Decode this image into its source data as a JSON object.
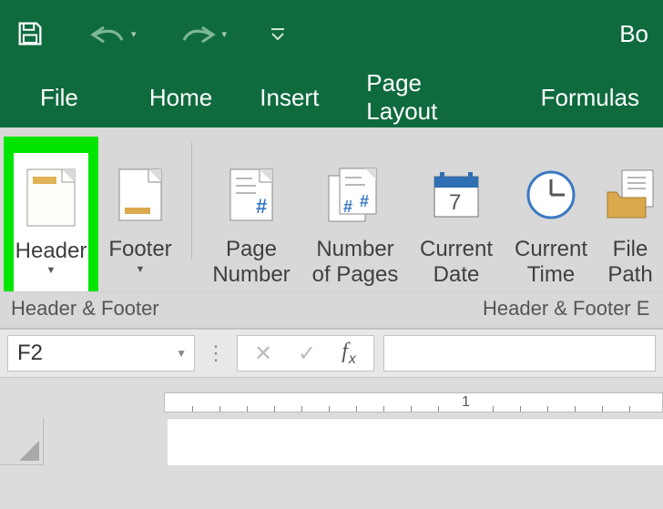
{
  "titlebar": {
    "right_text": "Bo"
  },
  "tabs": {
    "file": "File",
    "home": "Home",
    "insert": "Insert",
    "page_layout": "Page Layout",
    "formulas": "Formulas"
  },
  "ribbon": {
    "header": {
      "label": "Header"
    },
    "footer": {
      "label": "Footer"
    },
    "page_number": {
      "line1": "Page",
      "line2": "Number"
    },
    "number_of_pages": {
      "line1": "Number",
      "line2": "of Pages"
    },
    "current_date": {
      "line1": "Current",
      "line2": "Date"
    },
    "current_time": {
      "line1": "Current",
      "line2": "Time"
    },
    "file_path": {
      "line1": "File",
      "line2": "Path"
    },
    "group1": "Header & Footer",
    "group2": "Header & Footer E"
  },
  "formula_bar": {
    "namebox": "F2",
    "fx": "fx"
  },
  "ruler": {
    "label1": "1"
  }
}
